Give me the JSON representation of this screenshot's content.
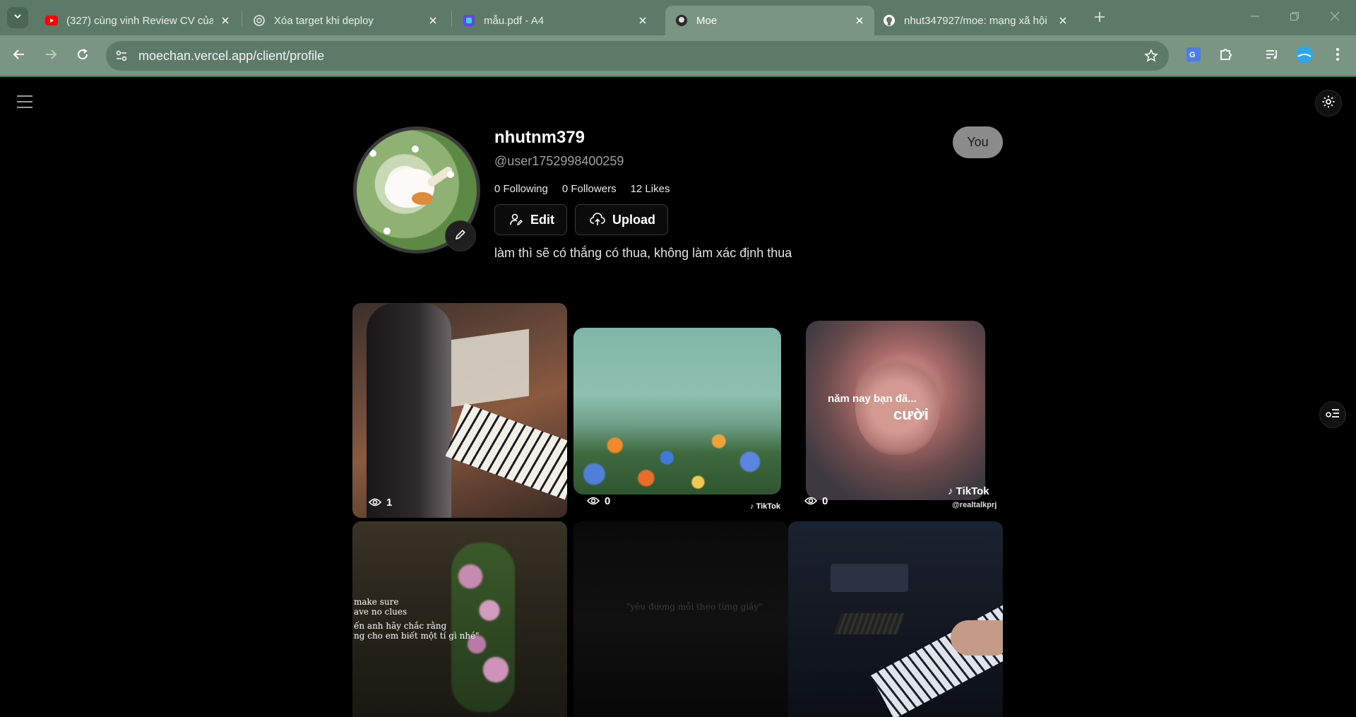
{
  "browser": {
    "tabs": [
      {
        "title": "(327) cùng vinh Review CV của",
        "icon": "youtube-icon"
      },
      {
        "title": "Xóa target khi deploy",
        "icon": "chatgpt-icon"
      },
      {
        "title": "mẫu.pdf - A4",
        "icon": "pdf-app-icon"
      },
      {
        "title": "Moe",
        "icon": "moe-icon",
        "active": true
      },
      {
        "title": "nhut347927/moe: mạng xã hội",
        "icon": "github-icon"
      }
    ],
    "url": "moechan.vercel.app/client/profile",
    "accent": "#7a9683"
  },
  "profile": {
    "username": "nhutnm379",
    "handle": "@user1752998400259",
    "following": "0 Following",
    "followers": "0 Followers",
    "likes": "12 Likes",
    "edit_label": "Edit",
    "upload_label": "Upload",
    "bio": "làm thì sẽ có thắng có thua, không làm xác định thua",
    "badge": "You"
  },
  "videos": [
    {
      "views": "1",
      "overlay": ""
    },
    {
      "views": "0",
      "watermark": "TikTok"
    },
    {
      "views": "0",
      "caption_top": "năm nay bạn đã...",
      "caption_main": "cười",
      "watermark": "TikTok",
      "watermark_handle": "@realtalkprj"
    },
    {
      "views": "",
      "lines": [
        "make sure",
        "ave no clues",
        "ến anh hãy chắc rằng",
        "ng cho em biết một tí gì nhé\""
      ]
    },
    {
      "views": "",
      "lines": [
        "\"yêu đương mỗi theo từng giây\""
      ]
    },
    {
      "views": ""
    }
  ]
}
